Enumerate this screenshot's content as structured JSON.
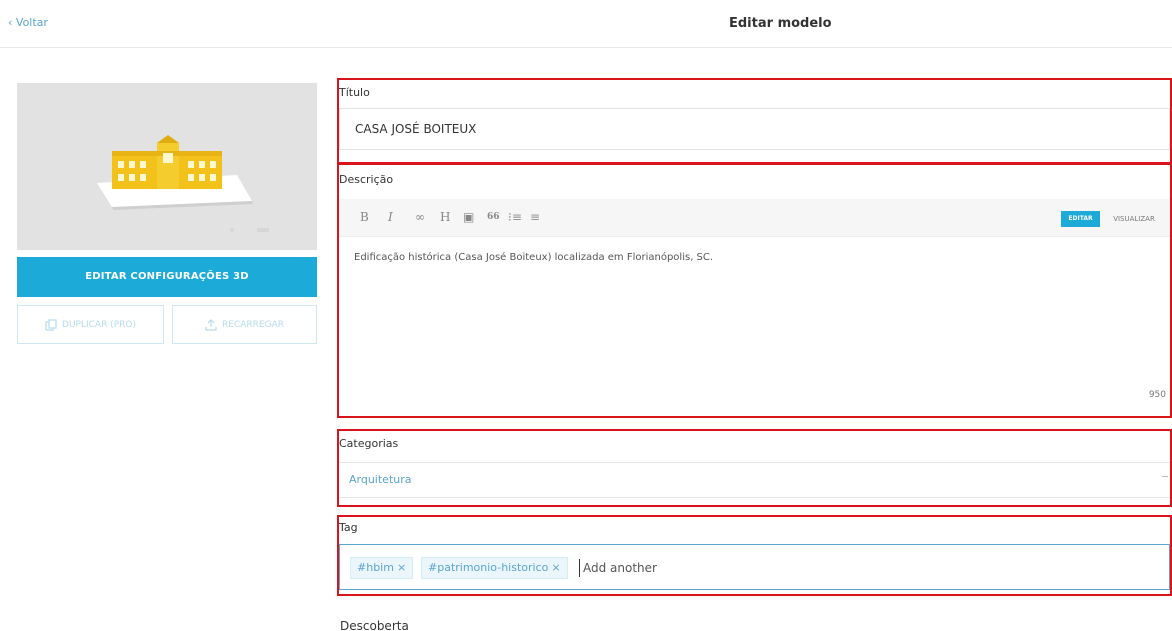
{
  "header": {
    "back_label": "‹ Voltar",
    "title": "Editar modelo"
  },
  "sidebar": {
    "edit_3d_label": "EDITAR CONFIGURAÇÕES 3D",
    "duplicate_label": "DUPLICAR (PRO)",
    "reload_label": "RECARREGAR"
  },
  "form": {
    "title_label": "Título",
    "title_value": "CASA JOSÉ BOITEUX",
    "description_label": "Descrição",
    "toolbar": {
      "bold": "B",
      "italic": "I",
      "link": "∞",
      "heading": "H",
      "image": "▣",
      "quote": "66",
      "ordered_list": "⁝≡",
      "bullet_list": "≡",
      "edit_tab": "EDITAR",
      "preview_tab": "VISUALIZAR"
    },
    "description_value": "Edificação histórica (Casa José Boiteux) localizada em Florianópolis, SC.",
    "char_count": "950",
    "categories_label": "Categorias",
    "category_value": "Arquitetura",
    "tag_label": "Tag",
    "tags": [
      "#hbim",
      "#patrimonio-historico"
    ],
    "tag_remove": "×",
    "tag_placeholder": "Add another",
    "discovery_label": "Descoberta"
  },
  "colors": {
    "accent": "#1caad9",
    "link": "#5ba4cf",
    "highlight_border": "#d9141b",
    "toggle_on": "#3fc25a",
    "building": "#f3c21a"
  }
}
